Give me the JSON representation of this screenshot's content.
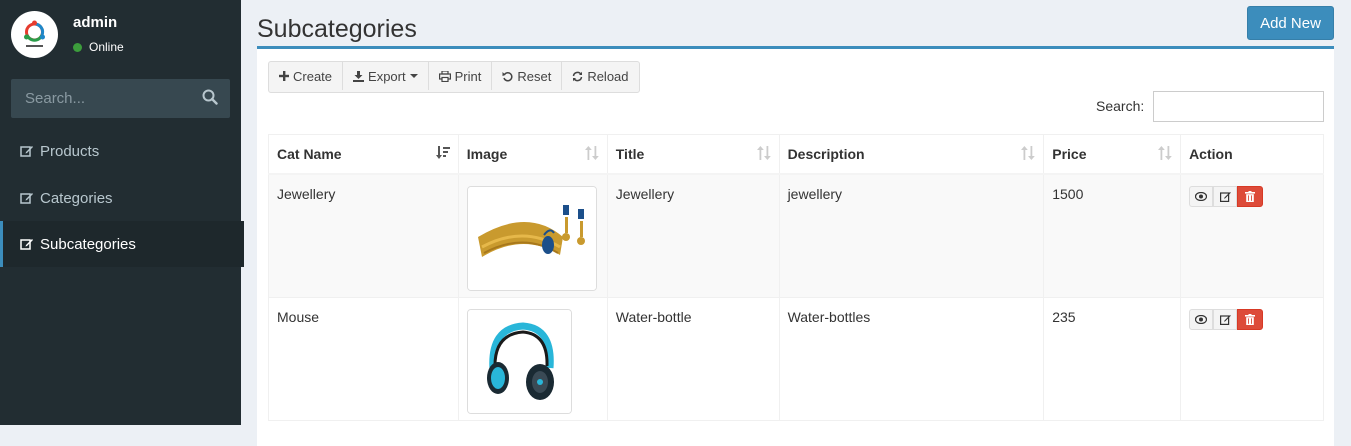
{
  "user": {
    "name": "admin",
    "status": "Online"
  },
  "sidebar": {
    "search_placeholder": "Search...",
    "items": [
      {
        "label": "Products",
        "active": false
      },
      {
        "label": "Categories",
        "active": false
      },
      {
        "label": "Subcategories",
        "active": true
      }
    ]
  },
  "page": {
    "title": "Subcategories",
    "add_new_label": "Add New"
  },
  "toolbar": {
    "create": "Create",
    "export": "Export",
    "print": "Print",
    "reset": "Reset",
    "reload": "Reload"
  },
  "table": {
    "search_label": "Search:",
    "columns": [
      "Cat Name",
      "Image",
      "Title",
      "Description",
      "Price",
      "Action"
    ],
    "rows": [
      {
        "cat_name": "Jewellery",
        "image": "jewellery-necklace-image",
        "title": "Jewellery",
        "description": "jewellery",
        "price": "1500"
      },
      {
        "cat_name": "Mouse",
        "image": "headphones-image",
        "title": "Water-bottle",
        "description": "Water-bottles",
        "price": "235"
      }
    ]
  },
  "colors": {
    "sidebar_bg": "#222d32",
    "accent": "#3c8dbc",
    "danger": "#dd4b39",
    "content_bg": "#ecf0f5"
  }
}
